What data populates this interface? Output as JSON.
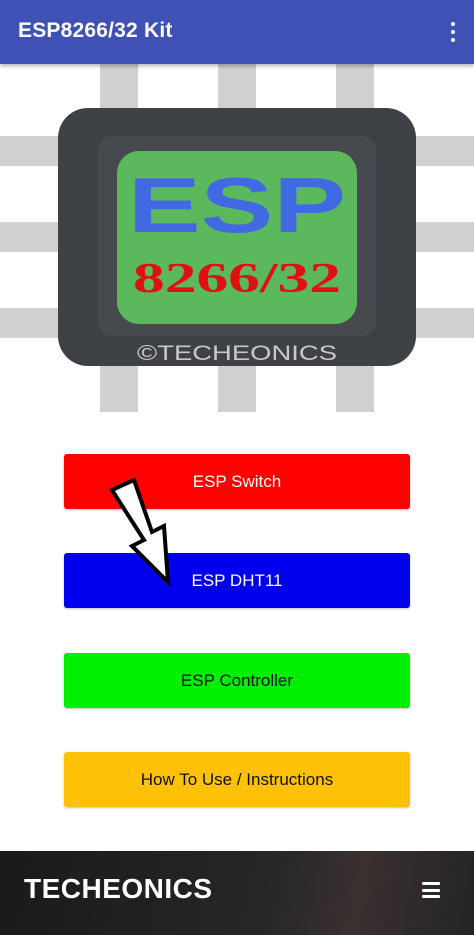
{
  "appbar": {
    "title": "ESP8266/32 Kit",
    "overflow_icon": "more-vert-icon"
  },
  "logo": {
    "main_text": "ESP",
    "chip_text": "8266/32",
    "watermark": "©TECHEONICS",
    "colors": {
      "pins": "#d0d0d0",
      "chip_body": "#3e4246",
      "chip_inner": "#464a4e",
      "die": "#5cb85c",
      "main_text": "#4169e1",
      "chip_text": "#e01010",
      "watermark": "#c8c8c8"
    }
  },
  "buttons": [
    {
      "label": "ESP Switch",
      "color": "#ff0000"
    },
    {
      "label": "ESP DHT11",
      "color": "#0000ee"
    },
    {
      "label": "ESP Controller",
      "color": "#00ee00"
    },
    {
      "label": "How To Use / Instructions",
      "color": "#ffc107"
    }
  ],
  "overlay": {
    "icon": "pointer-arrow-icon"
  },
  "footer": {
    "brand": "TECHEONICS",
    "menu_icon": "hamburger-menu-icon"
  }
}
